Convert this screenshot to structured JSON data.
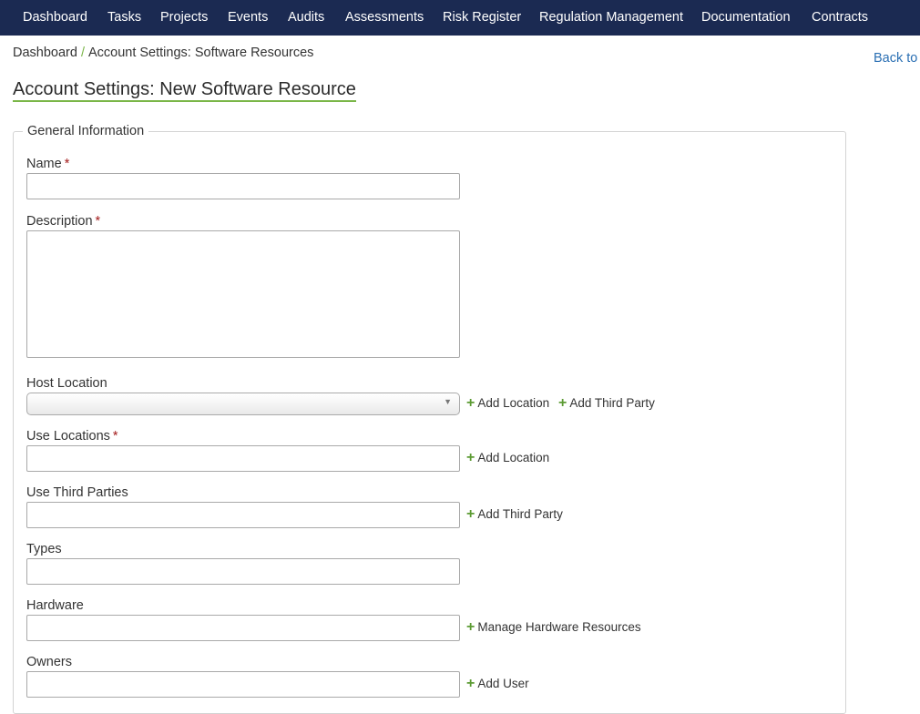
{
  "nav": {
    "items": [
      "Dashboard",
      "Tasks",
      "Projects",
      "Events",
      "Audits",
      "Assessments",
      "Risk Register",
      "Regulation Management",
      "Documentation",
      "Contracts"
    ]
  },
  "breadcrumb": {
    "home": "Dashboard",
    "separator": "/",
    "current": "Account Settings: Software Resources"
  },
  "back_link": "Back to",
  "page_title": "Account Settings: New Software Resource",
  "form": {
    "legend": "General Information",
    "required_mark": "*",
    "name_label": "Name",
    "description_label": "Description",
    "host_location_label": "Host Location",
    "use_locations_label": "Use Locations",
    "use_third_parties_label": "Use Third Parties",
    "types_label": "Types",
    "hardware_label": "Hardware",
    "owners_label": "Owners"
  },
  "actions": {
    "add_location": "Add Location",
    "add_third_party": "Add Third Party",
    "manage_hardware": "Manage Hardware Resources",
    "add_user": "Add User"
  },
  "icons": {
    "plus": "plus-icon",
    "dropdown": "chevron-down-icon"
  },
  "colors": {
    "nav_bg": "#1b2a52",
    "accent_green": "#7ab648",
    "link_blue": "#2a6fb3",
    "required_red": "#a31c1c"
  }
}
